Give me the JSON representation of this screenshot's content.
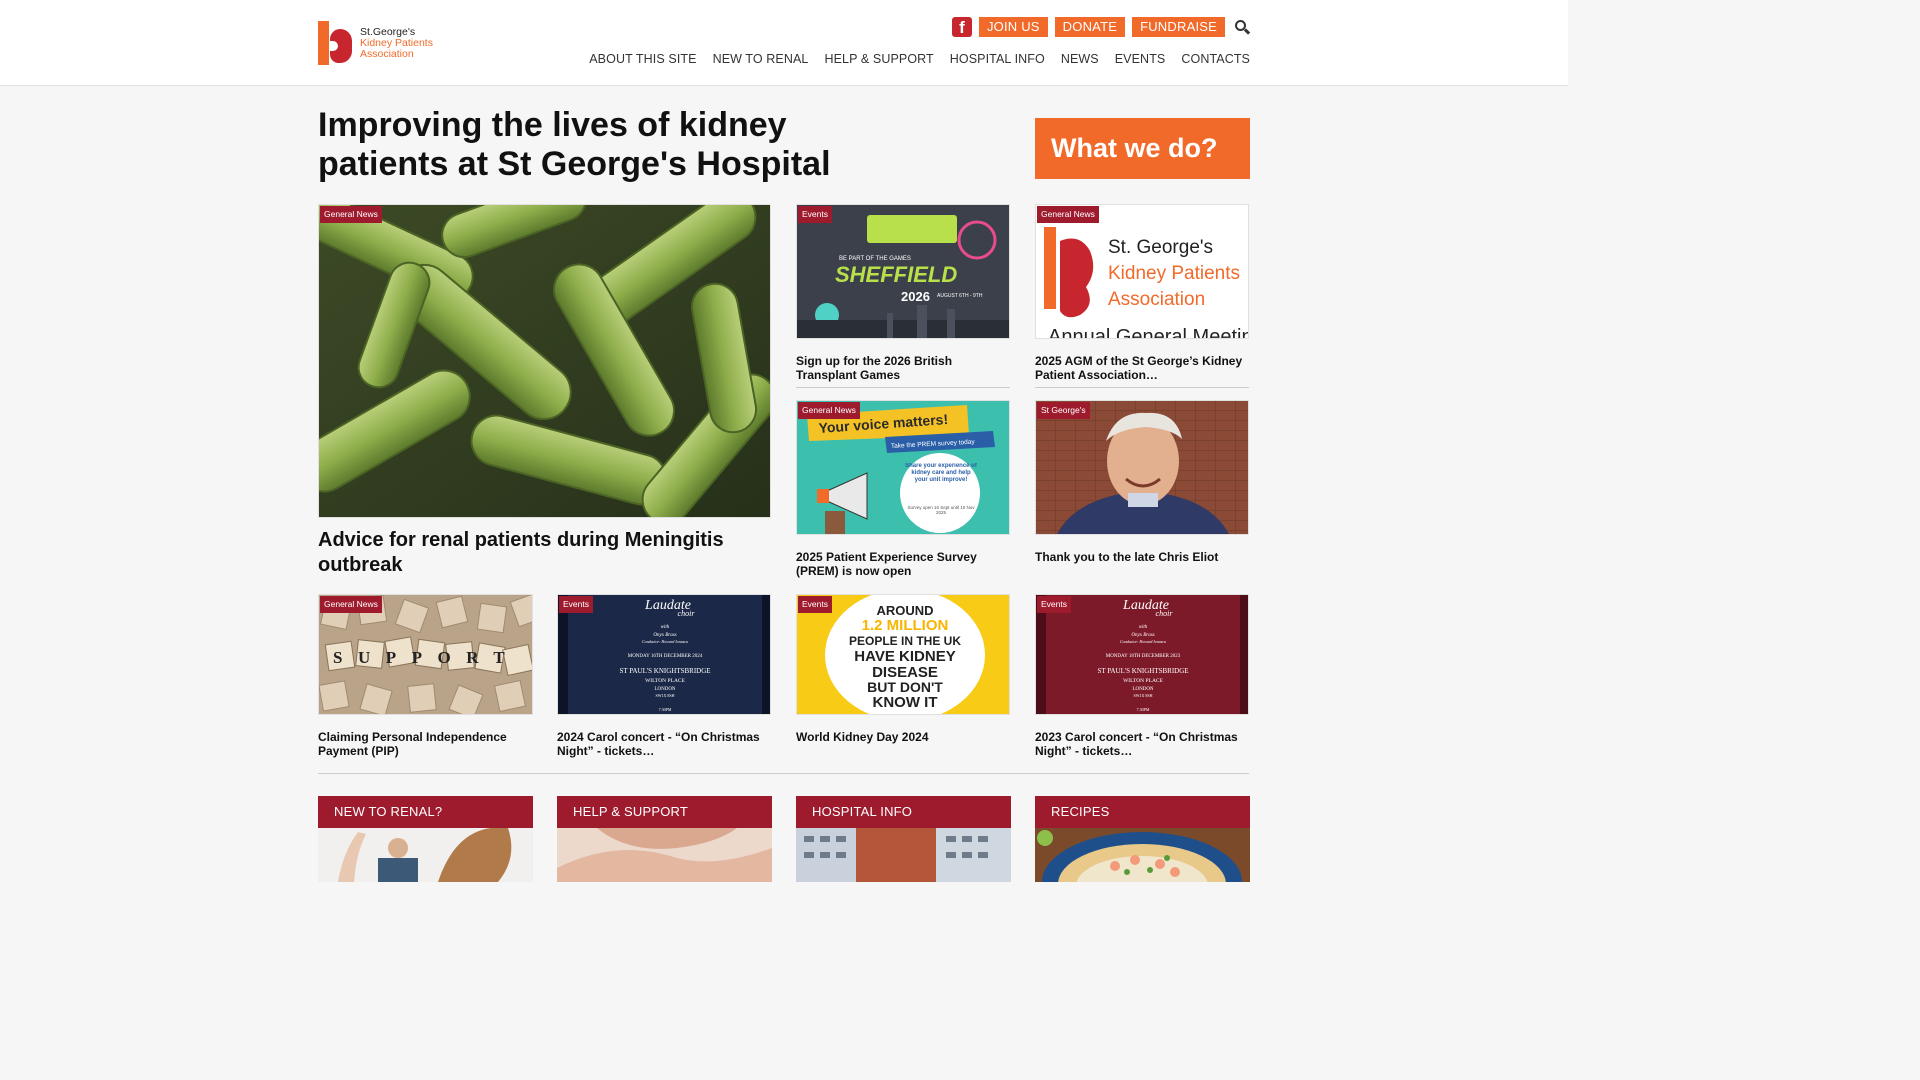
{
  "header": {
    "logo": {
      "line1": "St.George's",
      "line2": "Kidney Patients",
      "line3": "Association"
    },
    "facebook_glyph": "f",
    "utility_buttons": {
      "join": "JOIN US",
      "donate": "DONATE",
      "fundraise": "FUNDRAISE"
    },
    "nav": [
      "ABOUT THIS SITE",
      "NEW TO RENAL",
      "HELP & SUPPORT",
      "HOSPITAL INFO",
      "NEWS",
      "EVENTS",
      "CONTACTS"
    ],
    "icons": {
      "facebook": "facebook-icon",
      "search": "search-icon"
    }
  },
  "hero": {
    "title": "Improving the lives of kidney patients at St George's Hospital",
    "cta": "What we do?"
  },
  "featured": {
    "tag": "General News",
    "title": "Advice for renal patients during Meningitis outbreak"
  },
  "cards_row1": [
    {
      "tag": "Events",
      "title": "Sign up for the 2026 British Transplant Games",
      "img": {
        "top_small": "BE PART OF THE GAMES",
        "city": "SHEFFIELD",
        "year": "2026",
        "date": "AUGUST 6TH - 9TH"
      }
    },
    {
      "tag": "General News",
      "title": "2025 AGM of the St George’s Kidney Patient Association…",
      "img": {
        "l1": "St. George's",
        "l2": "Kidney Patients",
        "l3": "Association",
        "l4": "Annual General Meeting"
      }
    }
  ],
  "cards_row2": [
    {
      "tag": "General News",
      "title": "2025 Patient Experience Survey (PREM) is now open",
      "img": {
        "banner": "Your voice matters!",
        "sub": "Take the PREM survey today",
        "bubble": "Share your experience of kidney care and help your unit improve!",
        "dates": "Survey open 15 Sept until 10 Nov 2025"
      }
    },
    {
      "tag": "St George's",
      "title": "Thank you to the late Chris Eliot"
    }
  ],
  "cards_row3": [
    {
      "tag": "General News",
      "title": "Claiming Personal Independence Payment (PIP)",
      "img": {
        "tiles": "SUPPORT"
      }
    },
    {
      "tag": "Events",
      "title": "2024 Carol concert - “On Christmas Night” - tickets…",
      "img": {
        "choir": "Laudate",
        "choir2": "choir",
        "with": "with",
        "brass": "Onyx Brass",
        "cond": "Conductor: Howard Ionascu",
        "date": "MONDAY 16TH DECEMBER 2024",
        "venue": "ST PAUL'S KNIGHTSBRIDGE",
        "addr1": "WILTON PLACE",
        "addr2": "LONDON",
        "addr3": "SW1X 8SH",
        "time": "7.30PM"
      }
    },
    {
      "tag": "Events",
      "title": "World Kidney Day 2024",
      "img": {
        "l1": "AROUND",
        "l2": "1.2 MILLION",
        "l3": "PEOPLE IN THE UK",
        "l4": "HAVE KIDNEY",
        "l5": "DISEASE",
        "l6": "BUT DON'T",
        "l7": "KNOW IT"
      }
    },
    {
      "tag": "Events",
      "title": "2023 Carol concert - “On Christmas Night” - tickets…",
      "img": {
        "choir": "Laudate",
        "choir2": "choir",
        "with": "with",
        "brass": "Onyx Brass",
        "cond": "Conductor: Howard Ionascu",
        "date": "MONDAY 18TH DECEMBER 2023",
        "venue": "ST PAUL'S KNIGHTSBRIDGE",
        "addr1": "WILTON PLACE",
        "addr2": "LONDON",
        "addr3": "SW1X 8SH",
        "time": "7.30PM"
      }
    }
  ],
  "categories": [
    "NEW TO RENAL?",
    "HELP & SUPPORT",
    "HOSPITAL INFO",
    "RECIPES"
  ],
  "colors": {
    "orange": "#f26a2a",
    "maroon": "#9e1b2e",
    "red": "#c8262e"
  }
}
